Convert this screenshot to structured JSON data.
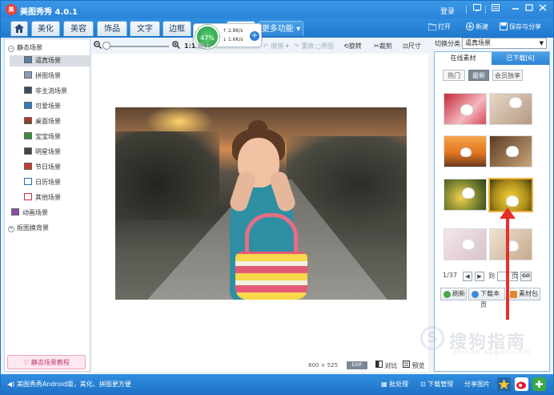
{
  "window": {
    "title": "美图秀秀 4.0.1",
    "logo_text": "美",
    "login_label": "登录",
    "controls": [
      "□",
      "—",
      "□",
      "✕"
    ]
  },
  "tabs": {
    "home_icon": "home-icon",
    "items": [
      "美化",
      "美容",
      "饰品",
      "文字",
      "边框",
      "拼图"
    ],
    "more_label": "更多功能"
  },
  "speed_widget": {
    "percent": "47%",
    "up": "2.8K/s",
    "down": "1.6K/s"
  },
  "top_right": {
    "open_label": "打开",
    "new_label": "新建",
    "save_label": "保存与分享"
  },
  "toolbar": {
    "fit_label": "1:1",
    "fit_suffix": "原大",
    "adjust_label": "撤销",
    "redo_label": "重做",
    "restore_label": "原图",
    "rotate_label": "旋转",
    "crop_label": "裁剪",
    "size_label": "尺寸"
  },
  "left_tree": {
    "static_group": "静态场景",
    "items": [
      "逼真场景",
      "拼图场景",
      "非主流场景",
      "可爱场景",
      "桌面场景",
      "宝宝场景",
      "明星场景",
      "节日场景",
      "日历场景",
      "其他场景"
    ],
    "selected_index": 0,
    "dynamic_group": "动画场景",
    "cutout_group": "抠图换背景",
    "tutorial_button": "静态场景教程"
  },
  "canvas": {
    "image_size": "800 × 525",
    "exif_label": "EXIF",
    "compare_label": "对比",
    "preview_label": "预览"
  },
  "right_panel": {
    "switch_label": "切换分类",
    "category_value": "逼真场景",
    "tab_online": "在线素材",
    "tab_downloaded": "已下载[6]",
    "filters": [
      "热门",
      "最新",
      "会员独享"
    ],
    "selected_filter": 1,
    "page_text": "1/37",
    "goto_label": "到",
    "page_unit": "页",
    "go_label": "GO",
    "refresh_label": "刷新",
    "download_page_label": "下载本页",
    "material_pack_label": "素材包"
  },
  "status_bar": {
    "text": "美图秀秀Android版，美化、拼图更方便",
    "batch_label": "批处理",
    "download_mgr_label": "下载管理",
    "share_label": "分享图片"
  },
  "watermark": {
    "mark": "S",
    "text": "搜狗指南",
    "sub": "zhinan.sogou.com"
  }
}
